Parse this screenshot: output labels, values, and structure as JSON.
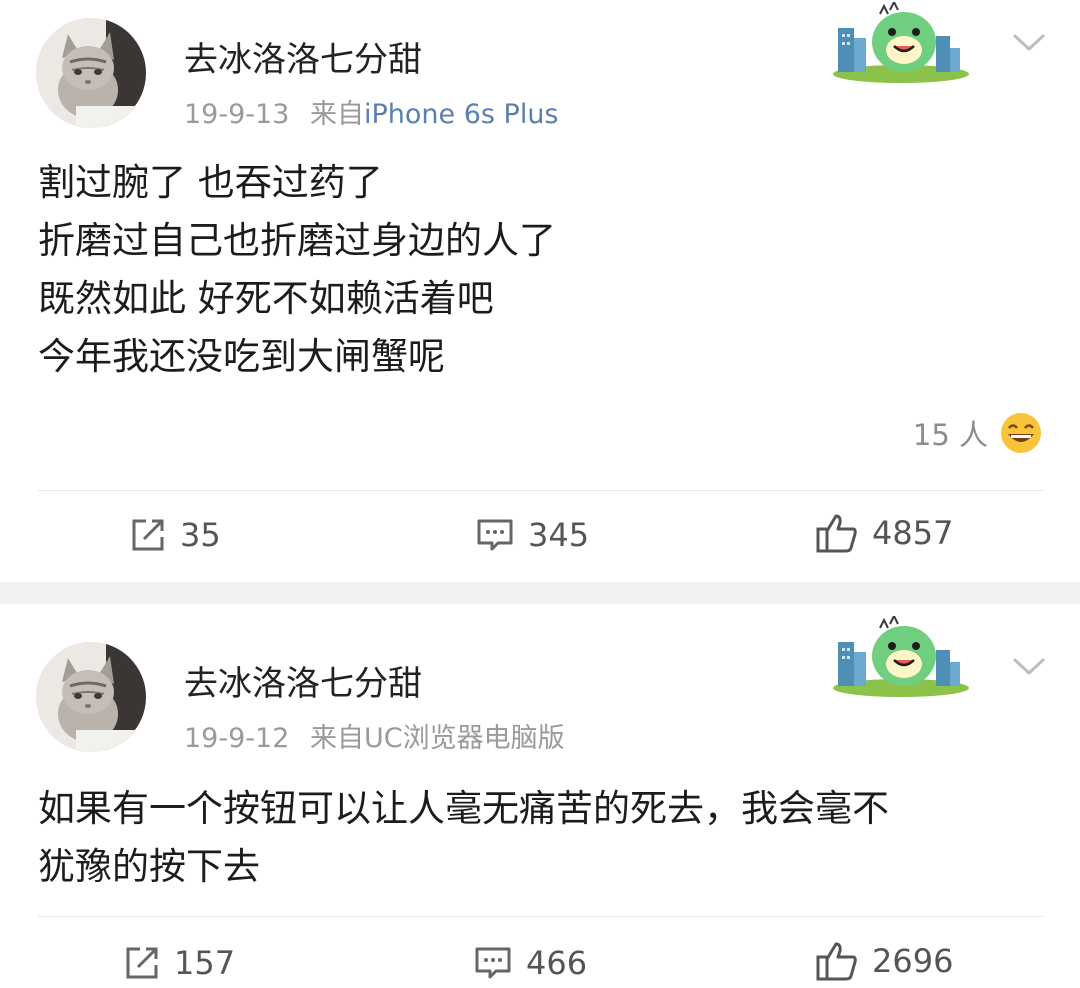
{
  "posts": [
    {
      "username": "去冰洛洛七分甜",
      "date": "19-9-13",
      "source_prefix": "来自",
      "source": "iPhone 6s Plus",
      "content": "割过腕了 也吞过药了\n折磨过自己也折磨过身边的人了\n既然如此 好死不如赖活着吧\n今年我还没吃到大闸蟹呢",
      "reaction_count": "15 人",
      "reposts": "35",
      "comments": "345",
      "likes": "4857"
    },
    {
      "username": "去冰洛洛七分甜",
      "date": "19-9-12",
      "source_prefix": "来自",
      "source": "UC浏览器电脑版",
      "content": "如果有一个按钮可以让人毫无痛苦的死去，我会毫不\n犹豫的按下去",
      "reposts": "157",
      "comments": "466",
      "likes": "2696"
    }
  ],
  "icons": {
    "repost": "repost-icon",
    "comment": "comment-icon",
    "like": "thumbs-up-icon",
    "more": "chevron-down-icon",
    "reaction": "laughing-emoji-icon",
    "badge": "dinosaur-badge-icon"
  },
  "colors": {
    "link_blue": "#5a7fb0",
    "meta_gray": "#9a9a9a",
    "separator": "#f2f2f2"
  }
}
